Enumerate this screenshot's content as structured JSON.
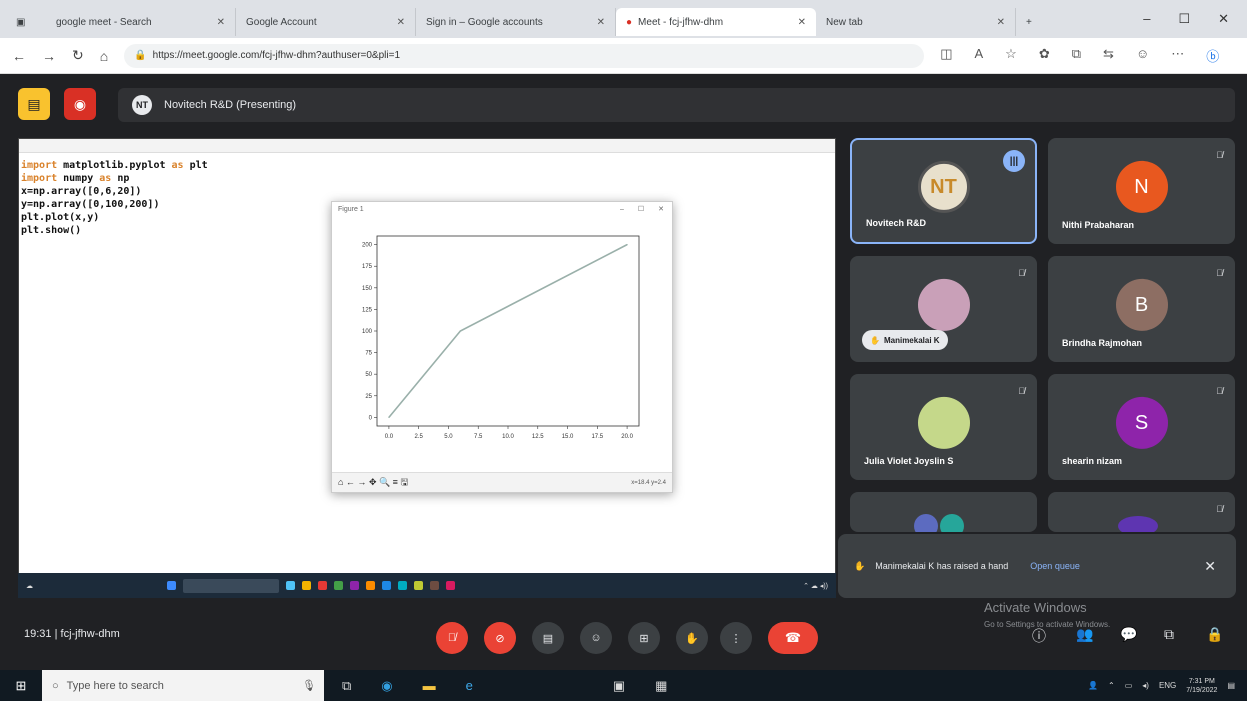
{
  "browser": {
    "tabs": [
      {
        "title": "google meet - Search",
        "active": false
      },
      {
        "title": "Google Account",
        "active": false
      },
      {
        "title": "Sign in – Google accounts",
        "active": false
      },
      {
        "title": "Meet - fcj-jfhw-dhm",
        "active": true
      },
      {
        "title": "New tab",
        "active": false
      }
    ],
    "url": "https://meet.google.com/fcj-jfhw-dhm?authuser=0&pli=1"
  },
  "meet": {
    "presenting_label": "Novitech R&D (Presenting)",
    "presenter_initials": "NT",
    "meeting_time": "19:31",
    "meeting_code": "fcj-jfhw-dhm"
  },
  "code": {
    "lines": [
      {
        "kw": "import",
        "rest": " matplotlib.pyplot ",
        "kw2": "as",
        "rest2": " plt"
      },
      {
        "kw": "import",
        "rest": " numpy ",
        "kw2": "as",
        "rest2": " np"
      },
      {
        "kw": "",
        "rest": "x=np.array([0,6,20])",
        "kw2": "",
        "rest2": ""
      },
      {
        "kw": "",
        "rest": "y=np.array([0,100,200])",
        "kw2": "",
        "rest2": ""
      },
      {
        "kw": "",
        "rest": "plt.plot(x,y)",
        "kw2": "",
        "rest2": ""
      },
      {
        "kw": "",
        "rest": "plt.show()",
        "kw2": "",
        "rest2": ""
      }
    ]
  },
  "plot_window": {
    "title": "Figure 1",
    "toolbar": "⌂ ← → ✥ 🔍 ≡ 🖫",
    "coord": "x=18.4 y=2.4"
  },
  "chart_data": {
    "type": "line",
    "x": [
      0,
      6,
      20
    ],
    "series": [
      {
        "values": [
          0,
          100,
          200
        ]
      }
    ],
    "xlim": [
      -1,
      21
    ],
    "ylim": [
      -10,
      210
    ],
    "xticks": [
      "0.0",
      "2.5",
      "5.0",
      "7.5",
      "10.0",
      "12.5",
      "15.0",
      "17.5",
      "20.0"
    ],
    "yticks": [
      "0",
      "25",
      "50",
      "75",
      "100",
      "125",
      "150",
      "175",
      "200"
    ],
    "line_color": "#9ab0aa"
  },
  "participants": [
    {
      "name": "Novitech R&D",
      "initials": "NT",
      "color": "#e8e0cc",
      "speaking": true
    },
    {
      "name": "Nithi Prabaharan",
      "initials": "N",
      "color": "#e8581f",
      "speaking": false
    },
    {
      "name": "Manimekalai K",
      "initials": "",
      "color": "#c9a0b8",
      "speaking": false,
      "hand_raised": true
    },
    {
      "name": "Brindha Rajmohan",
      "initials": "B",
      "color": "#8d6e63",
      "speaking": false
    },
    {
      "name": "Julia Violet Joyslin S",
      "initials": "",
      "color": "#c5d88a",
      "speaking": false
    },
    {
      "name": "shearin nizam",
      "initials": "S",
      "color": "#8e24aa",
      "speaking": false
    }
  ],
  "toast": {
    "message": "Manimekalai K has raised a hand",
    "action": "Open queue"
  },
  "activate": {
    "title": "Activate Windows",
    "sub": "Go to Settings to activate Windows."
  },
  "taskbar": {
    "search_placeholder": "Type here to search",
    "time": "7:31 PM",
    "date": "7/19/2022"
  }
}
